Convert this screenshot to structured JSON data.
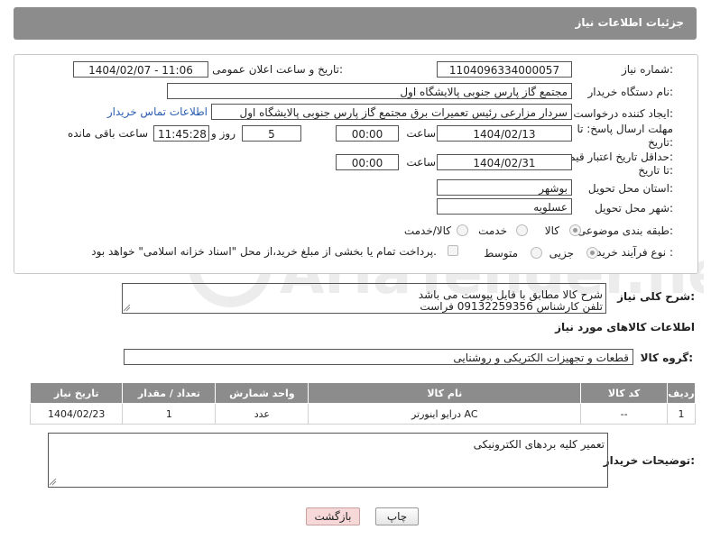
{
  "header": {
    "title": "جزئیات اطلاعات نیاز"
  },
  "form": {
    "need_number": {
      "label": "شماره نیاز:",
      "value": "1104096334000057"
    },
    "announce": {
      "label": "تاریخ و ساعت اعلان عمومی:",
      "value": "1404/02/07 - 11:06"
    },
    "buyer_org": {
      "label": "نام دستگاه خریدار:",
      "value": "مجتمع گاز پارس جنوبی  پالایشگاه اول"
    },
    "requester": {
      "label": "ایجاد کننده درخواست:",
      "value": "سردار مزارعی رئیس تعمیرات برق مجتمع گاز پارس جنوبی  پالایشگاه اول",
      "contact_link": "اطلاعات تماس خریدار"
    },
    "reply_deadline": {
      "label_line1": "مهلت ارسال پاسخ: تا",
      "label_line2": "تاریخ:",
      "date": "1404/02/13",
      "time_label": "ساعت",
      "time": "00:00",
      "days": "5",
      "days_label": "روز و",
      "remaining": "11:45:28",
      "remaining_label": "ساعت باقی مانده"
    },
    "price_validity": {
      "label_line1": "حداقل تاریخ اعتبار قیمت:",
      "label_line2": "تا تاریخ:",
      "date": "1404/02/31",
      "time_label": "ساعت",
      "time": "00:00"
    },
    "province": {
      "label": "استان محل تحویل:",
      "value": "بوشهر"
    },
    "city": {
      "label": "شهر محل تحویل:",
      "value": "عسلویه"
    },
    "category": {
      "label": "طبقه بندی موضوعی:",
      "options": [
        "کالا",
        "خدمت",
        "کالا/خدمت"
      ],
      "selected": "کالا"
    },
    "process": {
      "label": "نوع فرآیند خرید :",
      "options": [
        "جزیی",
        "متوسط"
      ],
      "selected": "جزیی",
      "note": "پرداخت تمام یا بخشی از مبلغ خرید،از محل \"اسناد خزانه اسلامی\" خواهد بود."
    }
  },
  "description": {
    "label": "شرح کلی نیاز:",
    "line1": "شرح کالا مطابق با فایل پیوست می باشد",
    "line2": "تلفن کارشناس 09132259356 فراست"
  },
  "goods_info": {
    "title": "اطلاعات کالاهای مورد نیاز",
    "group_label": "گروه کالا:",
    "group_value": "قطعات و تجهیزات الکتریکی و روشنایی",
    "columns": [
      "ردیف",
      "کد کالا",
      "نام کالا",
      "واحد شمارش",
      "تعداد / مقدار",
      "تاریخ نیاز"
    ],
    "rows": [
      {
        "row": "1",
        "code": "--",
        "name": "درایو اینورتر AC",
        "unit": "عدد",
        "qty": "1",
        "date": "1404/02/23"
      }
    ]
  },
  "buyer_notes": {
    "label": "توضیحات خریدار:",
    "text": "تعمیر کلیه بردهای الکترونیکی"
  },
  "buttons": {
    "print": "چاپ",
    "back": "بازگشت"
  },
  "watermark": {
    "text": "AriaTender.neT"
  },
  "colors": {
    "header_bg": "#8c8c8c",
    "link": "#2a5db0",
    "back_button_bg": "#f6d8d8"
  }
}
